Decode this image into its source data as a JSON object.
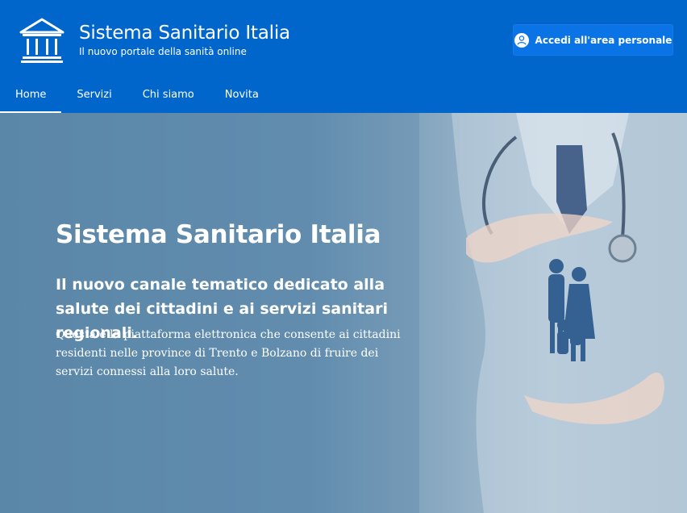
{
  "header": {
    "title": "Sistema Sanitario Italia",
    "subtitle": "Il nuovo portale della sanità online",
    "login_label": "Accedi all'area personale"
  },
  "nav": {
    "items": [
      {
        "label": "Home",
        "active": true
      },
      {
        "label": "Servizi"
      },
      {
        "label": "Chi siamo"
      },
      {
        "label": "Novita"
      }
    ]
  },
  "hero": {
    "title": "Sistema Sanitario Italia",
    "subtitle": "Il nuovo canale tematico dedicato alla salute dei cittadini e ai servizi sanitari regionali.",
    "text": "Questa è la piattaforma elettronica che consente ai cittadini residenti nelle province di Trento e Bolzano di fruire dei servizi connessi alla loro salute."
  },
  "icons": {
    "logo": "institution-building-icon",
    "login": "user-icon"
  },
  "colors": {
    "header_bg": "#0066cc",
    "button_bg": "#0a74e6",
    "hero_overlay": "#5e86a6"
  }
}
